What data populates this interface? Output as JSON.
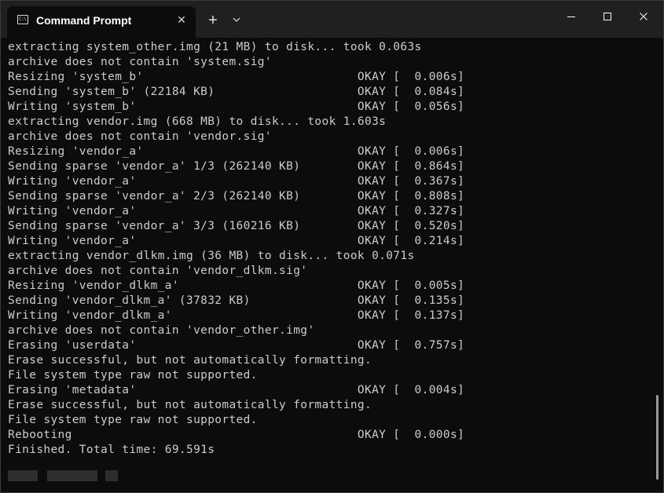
{
  "window": {
    "tab_title": "Command Prompt",
    "tab_icon_glyph": "C:\\",
    "close_tab_glyph": "✕",
    "new_tab_glyph": "+"
  },
  "terminal": {
    "lines": [
      "extracting system_other.img (21 MB) to disk... took 0.063s",
      "archive does not contain 'system.sig'",
      "Resizing 'system_b'                              OKAY [  0.006s]",
      "Sending 'system_b' (22184 KB)                    OKAY [  0.084s]",
      "Writing 'system_b'                               OKAY [  0.056s]",
      "extracting vendor.img (668 MB) to disk... took 1.603s",
      "archive does not contain 'vendor.sig'",
      "Resizing 'vendor_a'                              OKAY [  0.006s]",
      "Sending sparse 'vendor_a' 1/3 (262140 KB)        OKAY [  0.864s]",
      "Writing 'vendor_a'                               OKAY [  0.367s]",
      "Sending sparse 'vendor_a' 2/3 (262140 KB)        OKAY [  0.808s]",
      "Writing 'vendor_a'                               OKAY [  0.327s]",
      "Sending sparse 'vendor_a' 3/3 (160216 KB)        OKAY [  0.520s]",
      "Writing 'vendor_a'                               OKAY [  0.214s]",
      "extracting vendor_dlkm.img (36 MB) to disk... took 0.071s",
      "archive does not contain 'vendor_dlkm.sig'",
      "Resizing 'vendor_dlkm_a'                         OKAY [  0.005s]",
      "Sending 'vendor_dlkm_a' (37832 KB)               OKAY [  0.135s]",
      "Writing 'vendor_dlkm_a'                          OKAY [  0.137s]",
      "archive does not contain 'vendor_other.img'",
      "Erasing 'userdata'                               OKAY [  0.757s]",
      "Erase successful, but not automatically formatting.",
      "File system type raw not supported.",
      "Erasing 'metadata'                               OKAY [  0.004s]",
      "Erase successful, but not automatically formatting.",
      "File system type raw not supported.",
      "Rebooting                                        OKAY [  0.000s]",
      "Finished. Total time: 69.591s"
    ]
  },
  "colors": {
    "background": "#0c0c0c",
    "titlebar": "#202020",
    "text": "#cccccc"
  }
}
